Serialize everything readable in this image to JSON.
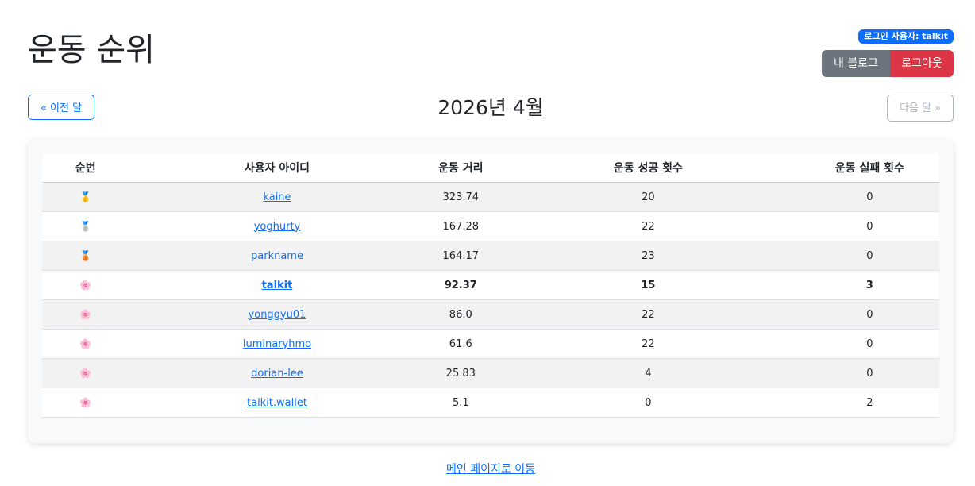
{
  "header": {
    "title": "운동 순위",
    "user_badge": "로그인 사용자: talkit",
    "my_blog_label": "내 블로그",
    "logout_label": "로그아웃"
  },
  "month_nav": {
    "prev_label": "« 이전 달",
    "current": "2026년 4월",
    "next_label": "다음 달 »",
    "next_disabled": true
  },
  "table": {
    "headers": [
      "순번",
      "사용자 아이디",
      "운동 거리",
      "운동 성공 횟수",
      "운동 실패 횟수"
    ],
    "rows": [
      {
        "rank_icon": "🥇",
        "icon_name": "gold-medal-icon",
        "user": "kaine",
        "distance": "323.74",
        "success": "20",
        "fail": "0"
      },
      {
        "rank_icon": "🥈",
        "icon_name": "silver-medal-icon",
        "user": "yoghurty",
        "distance": "167.28",
        "success": "22",
        "fail": "0"
      },
      {
        "rank_icon": "🥉",
        "icon_name": "bronze-medal-icon",
        "user": "parkname",
        "distance": "164.17",
        "success": "23",
        "fail": "0"
      },
      {
        "rank_icon": "🌸",
        "icon_name": "cherry-blossom-icon",
        "user": "talkit",
        "distance": "92.37",
        "success": "15",
        "fail": "3",
        "is_current_user": true
      },
      {
        "rank_icon": "🌸",
        "icon_name": "cherry-blossom-icon",
        "user": "yonggyu01",
        "distance": "86.0",
        "success": "22",
        "fail": "0"
      },
      {
        "rank_icon": "🌸",
        "icon_name": "cherry-blossom-icon",
        "user": "luminaryhmo",
        "distance": "61.6",
        "success": "22",
        "fail": "0"
      },
      {
        "rank_icon": "🌸",
        "icon_name": "cherry-blossom-icon",
        "user": "dorian-lee",
        "distance": "25.83",
        "success": "4",
        "fail": "0"
      },
      {
        "rank_icon": "🌸",
        "icon_name": "cherry-blossom-icon",
        "user": "talkit.wallet",
        "distance": "5.1",
        "success": "0",
        "fail": "2"
      }
    ]
  },
  "footer": {
    "main_link": "메인 페이지로 이동"
  },
  "colors": {
    "primary": "#0d6efd",
    "secondary": "#6c757d",
    "danger": "#dc3545",
    "card_bg": "#f8f9fa"
  }
}
